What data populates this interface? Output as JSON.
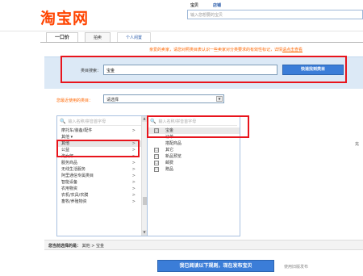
{
  "logo": "淘宝网",
  "search": {
    "tabs": [
      "宝贝",
      "店铺"
    ],
    "placeholder": "输入您想要的宝贝"
  },
  "tabs": [
    "一口价",
    "拍卖",
    "个人闲置"
  ],
  "notice": {
    "text": "亲爱的卖家，请您对照类目表认识一些卖家对分类要求的有效性标记，详情",
    "link": "请点击查看"
  },
  "category_search": {
    "label": "类目搜索：",
    "value": "宝金",
    "button": "快速找到类目"
  },
  "recent": {
    "label": "您最近使用的类目：",
    "selected": "请选择"
  },
  "column1": {
    "search_placeholder": "输入名称/拼音首字母",
    "items": [
      {
        "label": "摩托车/装备/配件",
        "chevron": ">",
        "selected": false
      },
      {
        "label": "其他 ▾",
        "chevron": "",
        "selected": false
      },
      {
        "label": "其他",
        "chevron": ">",
        "selected": true
      },
      {
        "label": "公益",
        "chevron": ">",
        "selected": false
      },
      {
        "label": "淘女郎",
        "chevron": ">",
        "selected": false
      },
      {
        "label": "服务商品",
        "chevron": ">",
        "selected": false
      },
      {
        "label": "无线生活服务",
        "chevron": ">",
        "selected": false
      },
      {
        "label": "阿里通信专属类目",
        "chevron": ">",
        "selected": false
      },
      {
        "label": "智能设备",
        "chevron": ">",
        "selected": false
      },
      {
        "label": "农用物资",
        "chevron": ">",
        "selected": false
      },
      {
        "label": "农机/农具/农膜",
        "chevron": ">",
        "selected": false
      },
      {
        "label": "畜牧/养殖物资",
        "chevron": ">",
        "selected": false
      }
    ]
  },
  "column2": {
    "search_placeholder": "输入名称/拼音首字母",
    "items": [
      {
        "label": "宝金",
        "icon": "☐",
        "selected": true
      },
      {
        "label": "订单",
        "icon": "",
        "selected": false
      },
      {
        "label": "搭配商品",
        "icon": "",
        "selected": false
      },
      {
        "label": "其它",
        "icon": "☐",
        "selected": false
      },
      {
        "label": "新品预览",
        "icon": "☐",
        "selected": false
      },
      {
        "label": "邮费",
        "icon": "☐",
        "selected": false
      },
      {
        "label": "赠品",
        "icon": "☐",
        "selected": false
      }
    ]
  },
  "right_edge_char": "充",
  "selected_path": {
    "label": "您当前选择的是：",
    "value": "其他 > 宝金"
  },
  "publish_button": "我已阅读以下规则，现在发布宝贝",
  "old_version_link": "使用旧版发布"
}
